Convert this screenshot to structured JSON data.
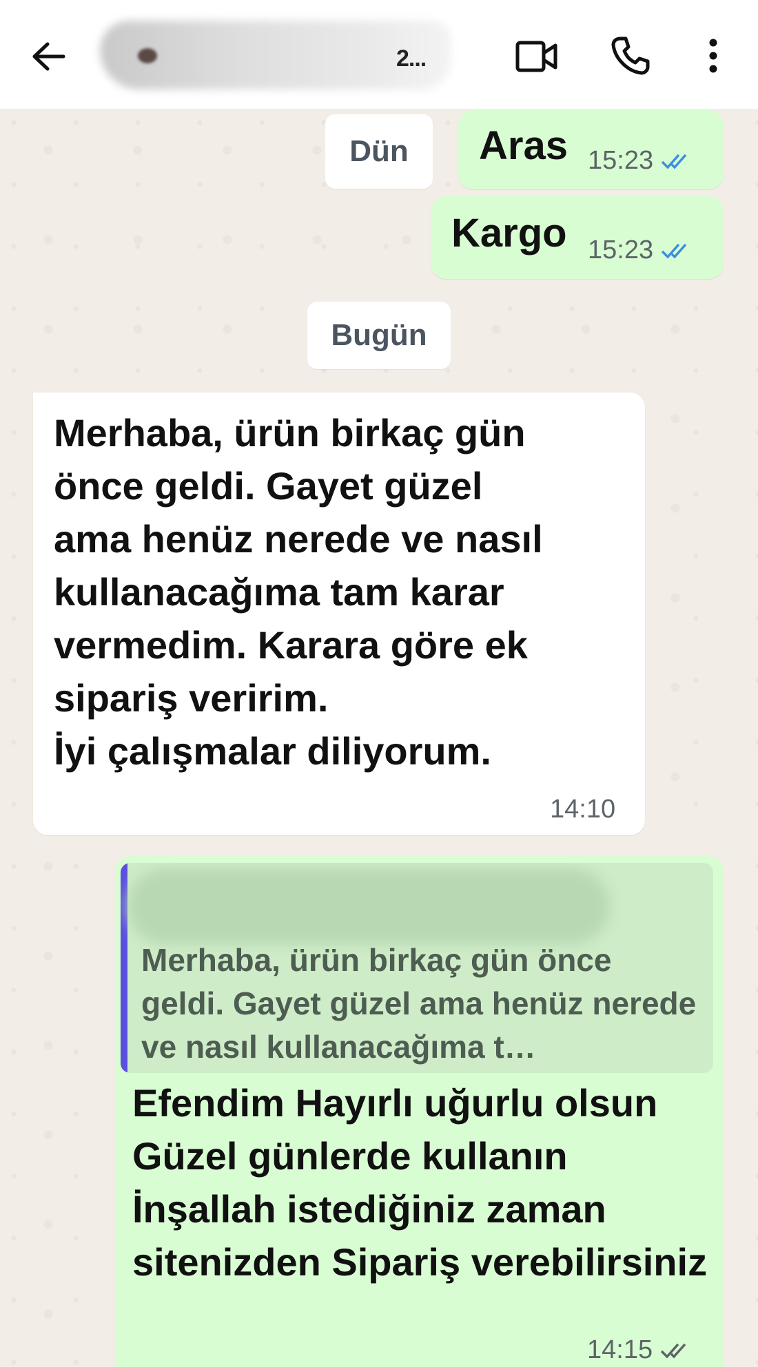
{
  "header": {
    "contact_name_visible": "2...",
    "icons": [
      "back-arrow-icon",
      "video-call-icon",
      "phone-icon",
      "more-vert-icon"
    ]
  },
  "dates": {
    "yesterday": "Dün",
    "today": "Bugün"
  },
  "messages": [
    {
      "direction": "out",
      "text": "Aras",
      "time": "15:23",
      "status": "read"
    },
    {
      "direction": "out",
      "text": "Kargo",
      "time": "15:23",
      "status": "read"
    },
    {
      "direction": "in",
      "text": "Merhaba, ürün birkaç gün\nönce geldi. Gayet güzel\nama henüz nerede ve nasıl\nkullanacağıma tam karar\nvermedim. Karara göre ek\nsipariş veririm.\nİyi çalışmalar diliyorum.",
      "time": "14:10"
    },
    {
      "direction": "out",
      "quoted": "Merhaba, ürün birkaç gün önce geldi. Gayet güzel ama henüz nerede ve nasıl kullanacağıma t…",
      "text": "Efendim Hayırlı uğurlu olsun Güzel günlerde kullanın İnşallah istediğiniz zaman sitenizden Sipariş verebilirsiniz",
      "time": "14:15",
      "status": "delivered"
    }
  ],
  "colors": {
    "outgoing_bubble": "#d9fdd3",
    "incoming_bubble": "#ffffff",
    "chat_background": "#f2ede6",
    "read_ticks": "#3b8fe0",
    "quote_bar": "#5b4fe0"
  }
}
